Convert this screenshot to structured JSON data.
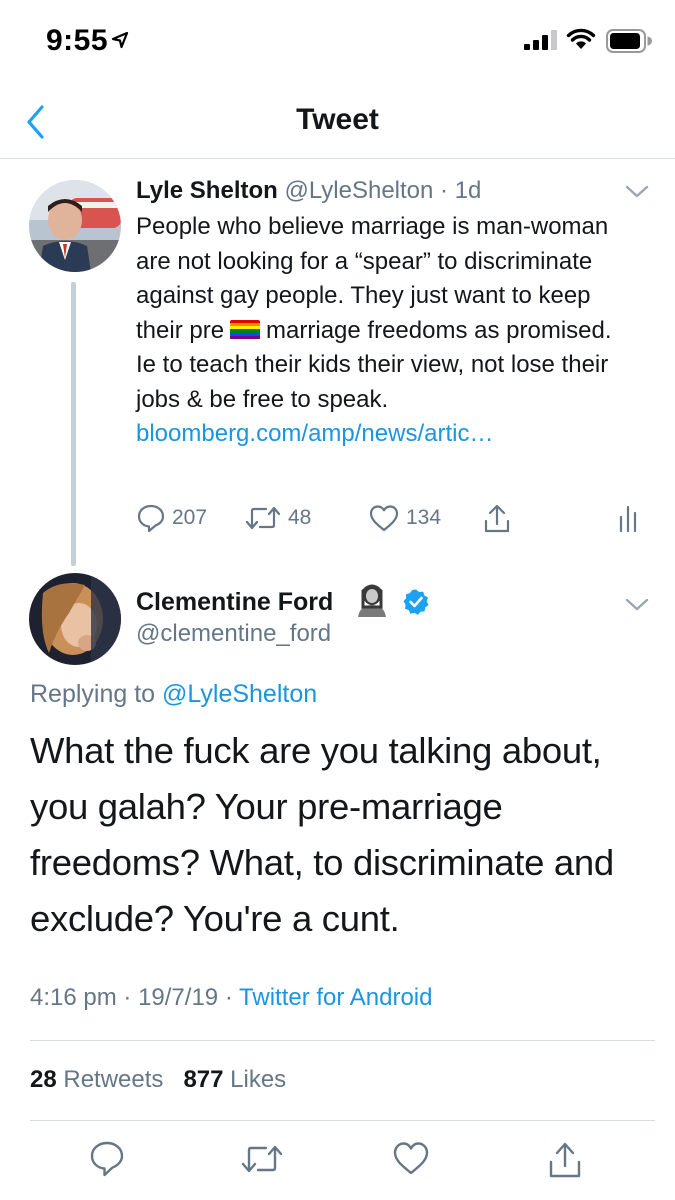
{
  "status_bar": {
    "time": "9:55"
  },
  "nav": {
    "title": "Tweet"
  },
  "parent_tweet": {
    "author_name": "Lyle Shelton",
    "handle": "@LyleShelton",
    "separator": " · ",
    "age": "1d",
    "text_before_flag": "People who believe marriage is man-woman are not looking for a “spear” to discriminate against gay people. They just want to keep their pre",
    "text_after_flag": "marriage freedoms as promised. Ie  to teach their kids their view, not lose their jobs & be free to speak.",
    "link": "bloomberg.com/amp/news/artic…",
    "replies": "207",
    "retweets": "48",
    "likes": "134"
  },
  "reply_tweet": {
    "author_name": "Clementine Ford",
    "handle": "@clementine_ford",
    "replying_prefix": "Replying to ",
    "replying_to": "@LyleShelton",
    "text": "What the fuck are you talking about, you galah? Your pre-marriage freedoms? What, to discriminate and exclude? You're a cunt.",
    "time": "4:16 pm",
    "date": "19/7/19",
    "source": "Twitter for Android",
    "retweet_count": "28",
    "retweet_label": "Retweets",
    "like_count": "877",
    "like_label": "Likes"
  },
  "icons": {
    "back": "chevron-left-icon",
    "reply": "speech-bubble-icon",
    "retweet": "retweet-arrows-icon",
    "like": "heart-icon",
    "share": "share-up-arrow-icon",
    "analytics": "bar-chart-icon",
    "verified": "verified-badge-icon",
    "more": "chevron-down-icon"
  },
  "colors": {
    "accent": "#1da1f2",
    "link": "#1b95e0",
    "muted": "#657786",
    "text": "#14171a",
    "divider": "#d8dde2"
  }
}
